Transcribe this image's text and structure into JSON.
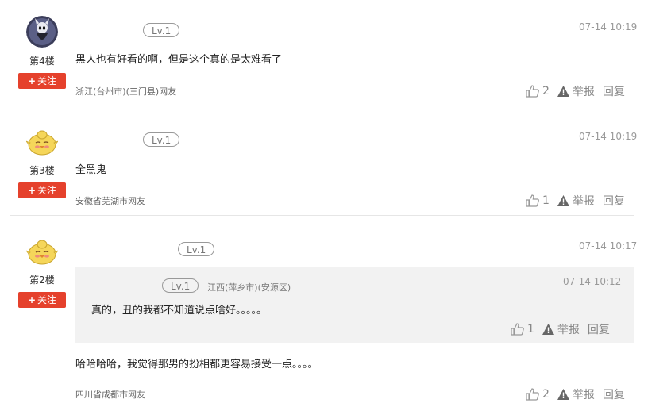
{
  "comments": [
    {
      "floor": "第4楼",
      "follow": "关注",
      "level": "Lv.1",
      "time": "07-14 10:19",
      "text": "黑人也有好看的啊，但是这个真的是太难看了",
      "location": "浙江(台州市)(三门县)网友",
      "likes": "2",
      "report": "举报",
      "reply": "回复",
      "avatar": "dark-knight-avatar"
    },
    {
      "floor": "第3楼",
      "follow": "关注",
      "level": "Lv.1",
      "time": "07-14 10:19",
      "text": "全黑鬼",
      "location": "安徽省芜湖市网友",
      "likes": "1",
      "report": "举报",
      "reply": "回复",
      "avatar": "yellow-chick-avatar"
    },
    {
      "floor": "第2楼",
      "follow": "关注",
      "level": "Lv.1",
      "time": "07-14 10:17",
      "text": "哈哈哈哈，我觉得那男的扮相都更容易接受一点。。。。",
      "location": "四川省成都市网友",
      "likes": "2",
      "report": "举报",
      "reply": "回复",
      "avatar": "yellow-chick-avatar",
      "quote": {
        "level": "Lv.1",
        "location": "江西(萍乡市)(安源区)",
        "time": "07-14 10:12",
        "text": "真的，丑的我都不知道说点啥好。。。。。",
        "likes": "1",
        "report": "举报",
        "reply": "回复"
      }
    }
  ],
  "colors": {
    "follow_bg": "#e5412c",
    "quote_bg": "#f2f2f2"
  }
}
